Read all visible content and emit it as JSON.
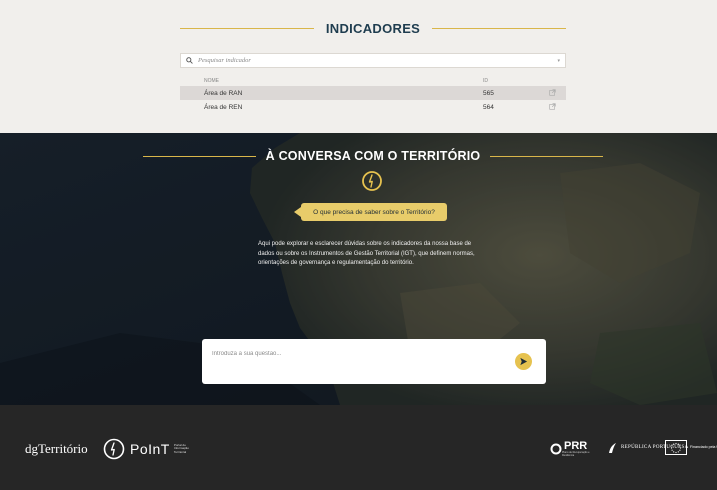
{
  "indicators": {
    "title": "INDICADORES",
    "search_placeholder": "Pesquisar indicador",
    "columns": {
      "name": "NOME",
      "id": "ID"
    },
    "rows": [
      {
        "name": "Área de RAN",
        "id": "565"
      },
      {
        "name": "Área de REN",
        "id": "564"
      }
    ]
  },
  "conversa": {
    "title": "À CONVERSA COM O TERRITÓRIO",
    "prompt_bubble": "O que precisa de saber sobre o Território?",
    "description": "Aqui pode explorar e esclarecer dúvidas sobre os indicadores da nossa base de dados ou sobre os Instrumentos de Gestão Territorial (IGT), que definem normas, orientações de governança e regulamentação do território.",
    "question_placeholder": "Introduza a sua questão..."
  },
  "footer": {
    "dgt_logo": "dgTerritório",
    "point_logo": "PoInT",
    "point_sub": "Portal de Informação Territorial",
    "prr_logo": "PRR",
    "prr_sub": "Plano de Recuperação e Resiliência",
    "republica_logo": "REPÚBLICA PORTUGUESA",
    "eu_text": "Financiado pela União Europeia NextGenerationEU"
  },
  "colors": {
    "accent_gold": "#e6c24f",
    "title_navy": "#1f3d4f",
    "footer_bg": "#262626",
    "indicators_bg": "#f1efec"
  },
  "icons": [
    "search-icon",
    "chevron-down-icon",
    "external-link-icon",
    "lightbulb-icon",
    "send-arrow-icon",
    "point-logo-icon",
    "prr-logo-icon",
    "republica-emblem-icon",
    "eu-flag-icon"
  ]
}
